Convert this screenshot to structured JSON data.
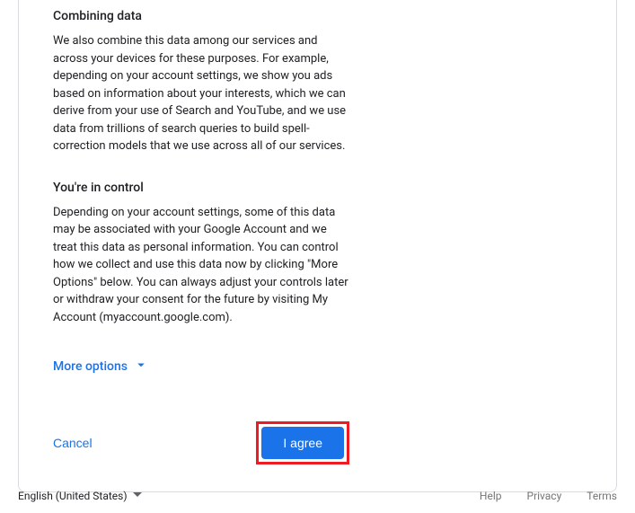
{
  "sections": {
    "combining": {
      "heading": "Combining data",
      "body": "We also combine this data among our services and across your devices for these purposes. For example, depending on your account settings, we show you ads based on information about your interests, which we can derive from your use of Search and YouTube, and we use data from trillions of search queries to build spell-correction models that we use across all of our services."
    },
    "control": {
      "heading": "You're in control",
      "body": "Depending on your account settings, some of this data may be associated with your Google Account and we treat this data as personal information. You can control how we collect and use this data now by clicking \"More Options\" below. You can always adjust your controls later or withdraw your consent for the future by visiting My Account (myaccount.google.com)."
    }
  },
  "more_options_label": "More options",
  "actions": {
    "cancel": "Cancel",
    "agree": "I agree"
  },
  "footer": {
    "language": "English (United States)",
    "help": "Help",
    "privacy": "Privacy",
    "terms": "Terms"
  }
}
